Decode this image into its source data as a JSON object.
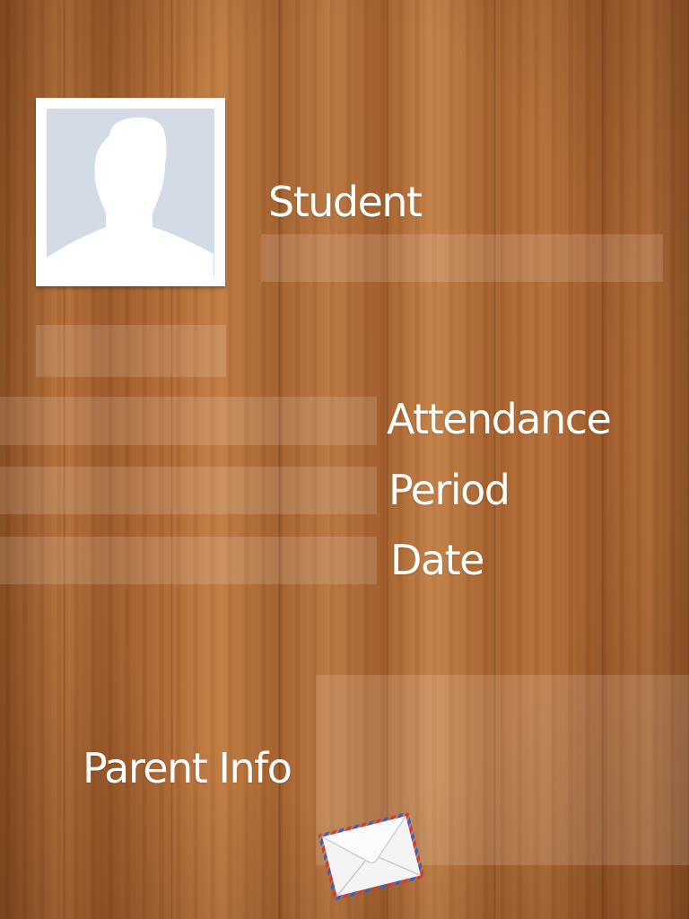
{
  "labels": {
    "student": "Student",
    "attendance": "Attendance",
    "period": "Period",
    "date": "Date",
    "parent_info": "Parent Info"
  },
  "icons": {
    "profile_photo": "person-silhouette-icon",
    "email": "envelope-icon"
  },
  "colors": {
    "wood": "#a8642d",
    "text": "#ffffff",
    "field": "rgba(255,255,255,0.14)",
    "photo_background": "#d3dbe7"
  }
}
